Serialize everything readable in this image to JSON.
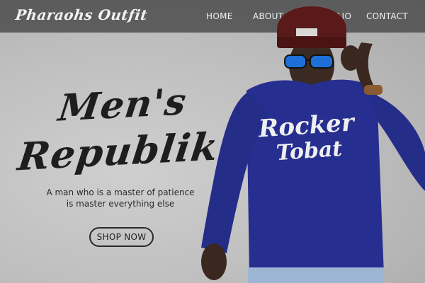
{
  "header": {
    "brand": "Pharaohs Outfit",
    "nav": [
      "HOME",
      "ABOUT",
      "PORTFOLIO",
      "CONTACT"
    ]
  },
  "hero": {
    "title_line1": "Men's",
    "title_line2": "Republik",
    "tagline_line1": "A man who is a master of patience",
    "tagline_line2": "is master everything else",
    "cta": "SHOP NOW"
  },
  "model": {
    "shirt_line1": "Rocker",
    "shirt_line2": "Tobat"
  },
  "colors": {
    "header_bg": "#555555",
    "shirt": "#262f8f",
    "beanie": "#5a1a1a",
    "text_dark": "#1e1e1e"
  }
}
